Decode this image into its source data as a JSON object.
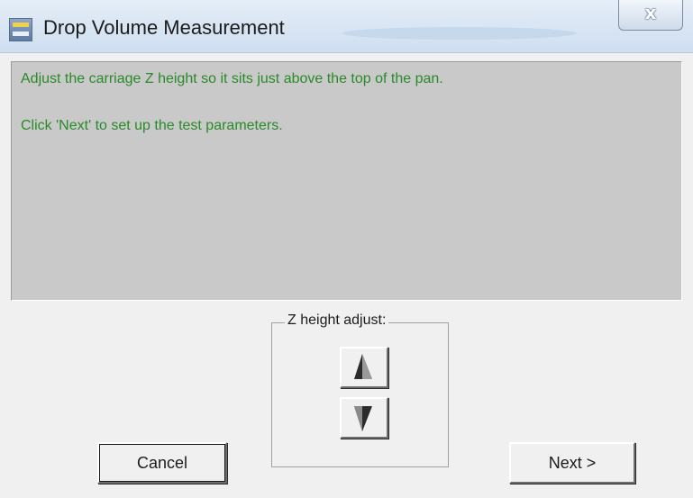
{
  "window": {
    "title": "Drop Volume Measurement",
    "icon": "app-icon",
    "close_glyph": "x"
  },
  "message": {
    "line1": "Adjust the carriage Z height so it sits just above the top of the pan.",
    "line2": "Click 'Next' to set up the test parameters.",
    "text_color": "#2a8a2a",
    "panel_color": "#c9c9c9"
  },
  "z_adjust": {
    "label": "Z height adjust:",
    "up_icon": "up-arrow-icon",
    "down_icon": "down-arrow-icon"
  },
  "buttons": {
    "cancel": "Cancel",
    "next": "Next >"
  }
}
